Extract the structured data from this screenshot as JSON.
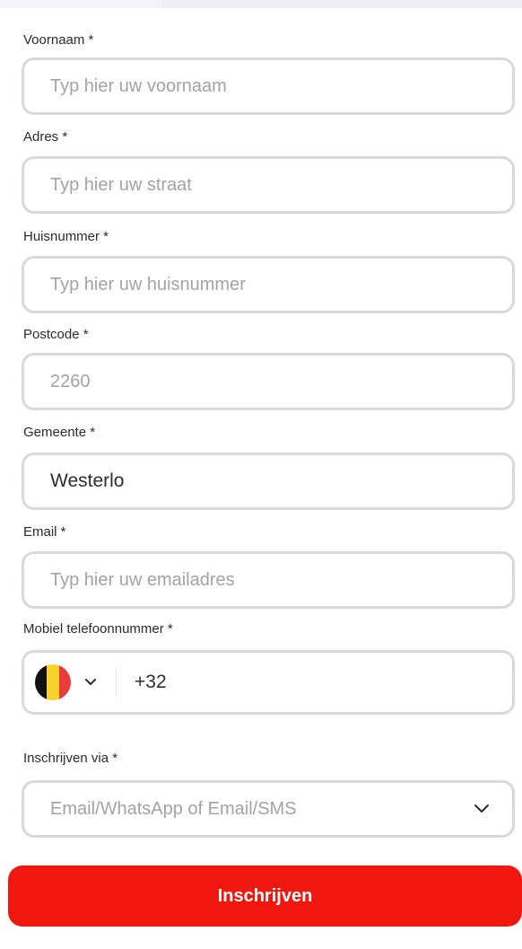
{
  "form": {
    "fields": [
      {
        "label": "Voornaam *",
        "placeholder": "Typ hier uw voornaam",
        "value": ""
      },
      {
        "label": "Adres *",
        "placeholder": "Typ hier uw straat",
        "value": ""
      },
      {
        "label": "Huisnummer *",
        "placeholder": "Typ hier uw  huisnummer",
        "value": ""
      },
      {
        "label": "Postcode *",
        "placeholder": "2260",
        "value": ""
      },
      {
        "label": "Gemeente *",
        "placeholder": "",
        "value": "Westerlo"
      },
      {
        "label": "Email *",
        "placeholder": "Typ hier uw emailadres",
        "value": ""
      }
    ],
    "phone": {
      "label": "Mobiel telefoonnummer *",
      "country_code": "+32",
      "flag_colors": [
        "#111111",
        "#f6d22c",
        "#ea3b3b"
      ]
    },
    "signup_via": {
      "label": "Inschrijven via *",
      "placeholder": "Email/WhatsApp of Email/SMS"
    },
    "submit_label": "Inschrijven"
  },
  "colors": {
    "primary": "#f0170f",
    "border": "#d8d9de",
    "background": "#f3f4f8"
  },
  "icons": {
    "phone_dropdown": "chevron-down-icon",
    "select_dropdown": "chevron-down-icon"
  }
}
